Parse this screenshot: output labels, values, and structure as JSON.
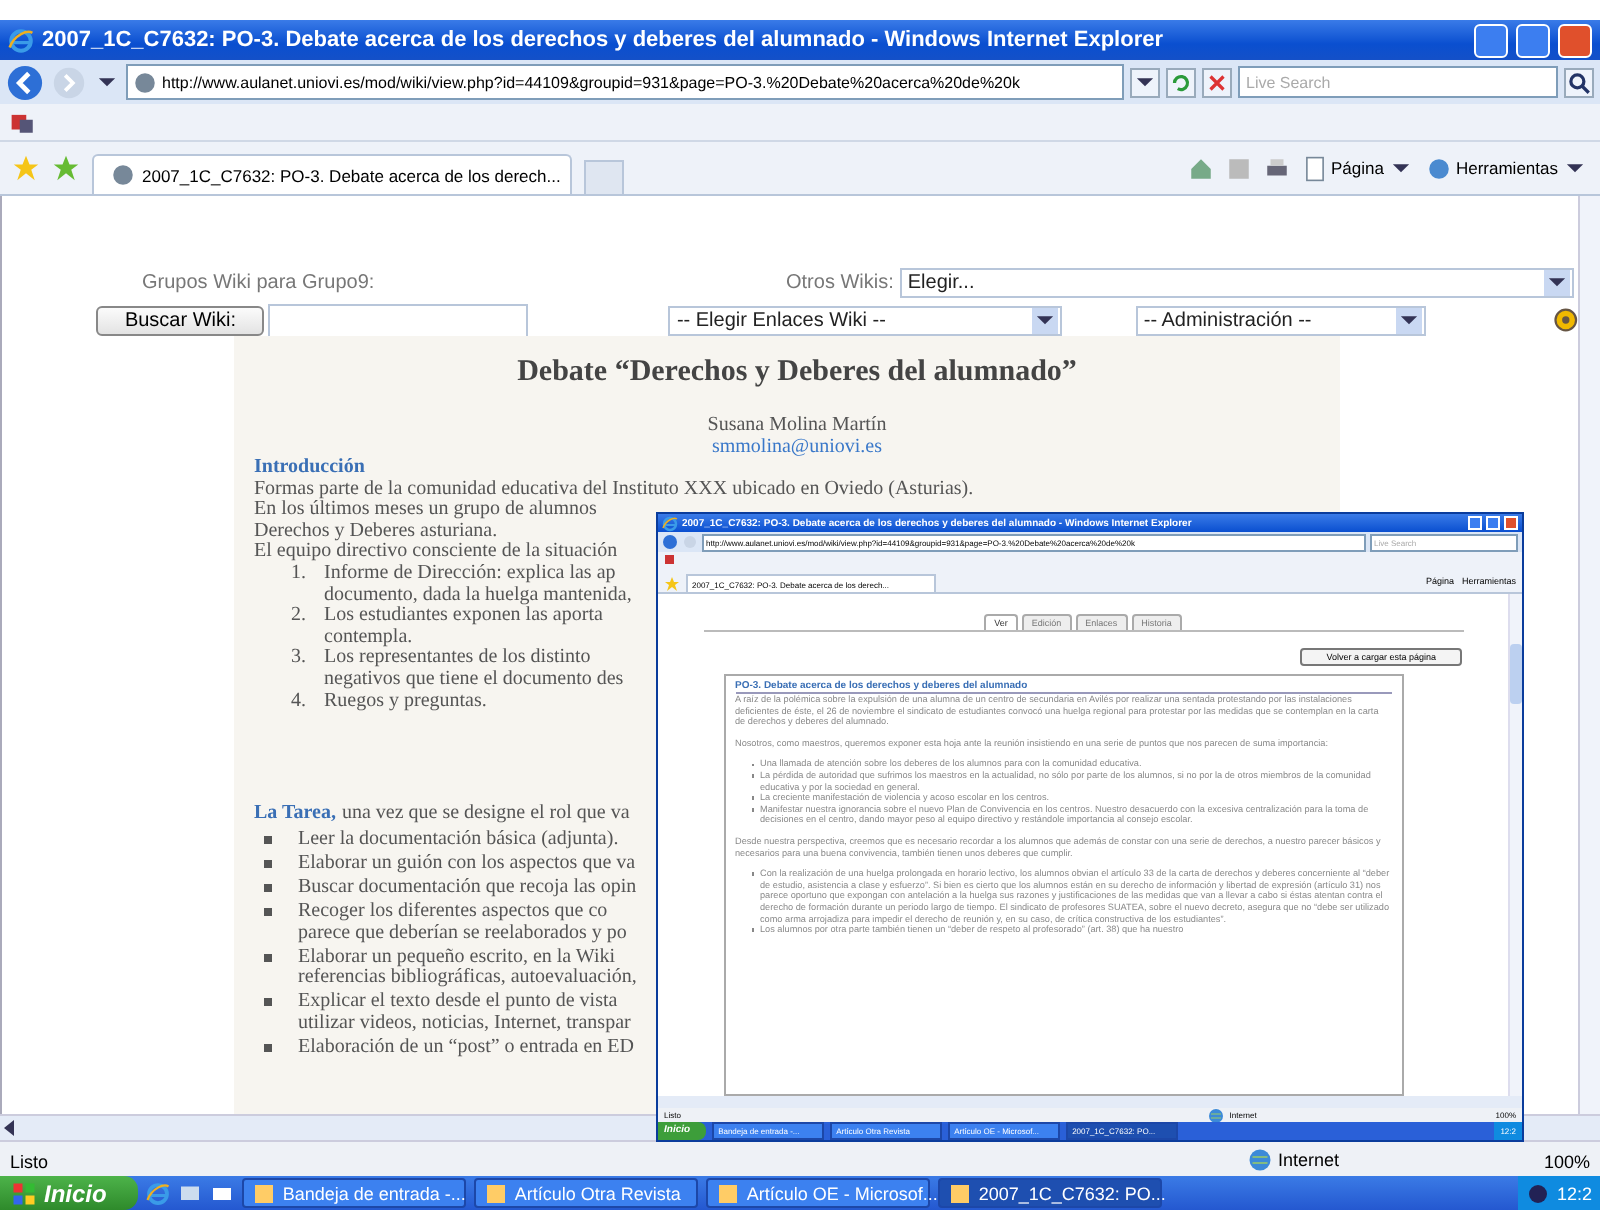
{
  "window": {
    "title": "2007_1C_C7632: PO-3. Debate acerca de los derechos y deberes del alumnado - Windows Internet Explorer"
  },
  "address_bar": {
    "url": "http://www.aulanet.uniovi.es/mod/wiki/view.php?id=44109&groupid=931&page=PO-3.%20Debate%20acerca%20de%20k",
    "search_placeholder": "Live Search"
  },
  "browser_tabs": [
    {
      "label": "2007_1C_C7632: PO-3. Debate acerca de los derech...",
      "selected": true
    }
  ],
  "command_bar": [
    {
      "label": "Página"
    },
    {
      "label": "Herramientas"
    }
  ],
  "wiki_toolbar": {
    "groups_label": "Grupos Wiki para Grupo9:",
    "other_wikis_label": "Otros Wikis:",
    "other_wikis_value": "Elegir...",
    "search_button": "Buscar Wiki:",
    "links_select": "-- Elegir Enlaces Wiki --",
    "admin_select": "-- Administración --"
  },
  "article": {
    "title": "Debate “Derechos y Deberes del alumnado”",
    "author": "Susana Molina Martín",
    "email": "smmolina@uniovi.es",
    "blocks": [
      {
        "kind": "heading",
        "text": "Introducción"
      },
      {
        "kind": "line",
        "text": "Formas parte de la comunidad educativa del Instituto XXX ubicado en Oviedo (Asturias)."
      },
      {
        "kind": "line",
        "text": "En los últimos meses un grupo de alumnos"
      },
      {
        "kind": "line",
        "text": "Derechos y Deberes asturiana."
      },
      {
        "kind": "line",
        "text": "El equipo directivo consciente de la situación"
      },
      {
        "kind": "numbered",
        "number": "1.",
        "lines": [
          "Informe de Dirección: explica las ap",
          "documento, dada la huelga mantenida,"
        ]
      },
      {
        "kind": "numbered",
        "number": "2.",
        "lines": [
          "Los estudiantes exponen las aporta",
          "contempla."
        ]
      },
      {
        "kind": "numbered",
        "number": "3.",
        "lines": [
          "Los representantes de los distinto",
          "negativos que tiene el documento des"
        ]
      },
      {
        "kind": "numbered",
        "number": "4.",
        "lines": [
          "Ruegos y preguntas."
        ]
      },
      {
        "kind": "lead",
        "label": "La Tarea,",
        "text": "una vez que se designe el rol que va"
      },
      {
        "kind": "bullet",
        "lines": [
          "Leer la documentación básica (adjunta)."
        ]
      },
      {
        "kind": "bullet",
        "lines": [
          "Elaborar un guión con los aspectos que va"
        ]
      },
      {
        "kind": "bullet",
        "lines": [
          "Buscar documentación que recoja las opin"
        ]
      },
      {
        "kind": "bullet",
        "lines": [
          "Recoger los diferentes aspectos que co",
          "parece que deberían se reelaborados y po"
        ]
      },
      {
        "kind": "bullet",
        "lines": [
          "Elaborar un pequeño escrito, en la Wiki",
          "referencias bibliográficas, autoevaluación,"
        ]
      },
      {
        "kind": "bullet",
        "lines": [
          "Explicar el texto desde el punto de vista",
          "utilizar videos, noticias, Internet, transpar"
        ]
      },
      {
        "kind": "bullet",
        "lines": [
          "Elaboración de un “post” o entrada en ED"
        ]
      }
    ]
  },
  "status_bar": {
    "text": "Listo",
    "zone": "Internet",
    "zoom": "100%"
  },
  "taskbar": {
    "start": "Inicio",
    "items": [
      {
        "label": "Bandeja de entrada -...",
        "selected": false
      },
      {
        "label": "Artículo Otra Revista",
        "selected": false
      },
      {
        "label": "Artículo OE - Microsof...",
        "selected": false
      },
      {
        "label": "2007_1C_C7632: PO...",
        "selected": true
      }
    ],
    "clock": "12:2"
  },
  "inset_screenshot": {
    "title": "2007_1C_C7632: PO-3. Debate acerca de los derechos y deberes del alumnado - Windows Internet Explorer",
    "url": "http://www.aulanet.uniovi.es/mod/wiki/view.php?id=44109&groupid=931&page=PO-3.%20Debate%20acerca%20de%20k",
    "search_placeholder": "Live Search",
    "tab_label": "2007_1C_C7632: PO-3. Debate acerca de los derech...",
    "command_bar": [
      {
        "label": "Página"
      },
      {
        "label": "Herramientas"
      }
    ],
    "page_tabs": [
      {
        "label": "Ver",
        "selected": true
      },
      {
        "label": "Edición",
        "selected": false
      },
      {
        "label": "Enlaces",
        "selected": false
      },
      {
        "label": "Historia",
        "selected": false
      }
    ],
    "reload_button": "Volver a cargar esta página",
    "heading": "PO-3. Debate acerca de los derechos y deberes del alumnado",
    "blocks": [
      {
        "kind": "para",
        "text": "A raíz de la polémica sobre la expulsión de una alumna de un centro de secundaria en Avilés por realizar una sentada protestando por las instalaciones deficientes de éste, el 26 de noviembre el sindicato de estudiantes convocó una huelga regional para protestar por las medidas que se contemplan en la carta de derechos y deberes del alumnado."
      },
      {
        "kind": "para",
        "text": "Nosotros, como maestros, queremos exponer esta hoja ante la reunión insistiendo en una serie de puntos que nos parecen de suma importancia:"
      },
      {
        "kind": "list",
        "items": [
          "Una llamada de atención sobre los deberes de los alumnos para con la comunidad educativa.",
          "La pérdida de autoridad que sufrimos los maestros en la actualidad, no sólo por parte de los alumnos, si no por la de otros miembros de la comunidad educativa y por la sociedad en general.",
          "La creciente manifestación de violencia y acoso escolar en los centros.",
          "Manifestar nuestra ignorancia sobre el nuevo Plan de Convivencia en los centros. Nuestro desacuerdo con la excesiva centralización para la toma de decisiones en el centro, dando mayor peso al equipo directivo y restándole importancia al consejo escolar."
        ]
      },
      {
        "kind": "para",
        "text": "Desde nuestra perspectiva, creemos que es necesario recordar a los alumnos que además de constar con una serie de derechos, a nuestro parecer básicos y necesarios para una buena convivencia, también tienen unos deberes que cumplir."
      },
      {
        "kind": "list",
        "items": [
          "Con la realización de una huelga prolongada en horario lectivo, los alumnos obvian el artículo 33 de la carta de derechos y deberes concerniente al “deber de estudio, asistencia a clase y esfuerzo”. Si bien es cierto que los alumnos están en su derecho de información y libertad de expresión (artículo 31) nos parece oportuno que expongan con antelación a la huelga sus razones y justificaciones de las medidas que van a llevar a cabo si éstas atentan contra el derecho de formación durante un periodo largo de tiempo. El sindicato de profesores SUATEA, sobre el nuevo decreto, asegura que no “debe ser utilizado como arma arrojadiza para impedir el derecho de reunión y, en su caso, de crítica constructiva de los estudiantes”.",
          "Los alumnos por otra parte también tienen un “deber de respeto al profesorado” (art. 38) que ha nuestro"
        ]
      }
    ],
    "status_bar": {
      "text": "Listo",
      "zone": "Internet",
      "zoom": "100%"
    },
    "taskbar": {
      "start": "Inicio",
      "items": [
        {
          "label": "Bandeja de entrada -...",
          "selected": false
        },
        {
          "label": "Artículo Otra Revista",
          "selected": false
        },
        {
          "label": "Artículo OE - Microsof...",
          "selected": false
        },
        {
          "label": "2007_1C_C7632: PO...",
          "selected": true
        }
      ],
      "clock": "12:2"
    }
  }
}
